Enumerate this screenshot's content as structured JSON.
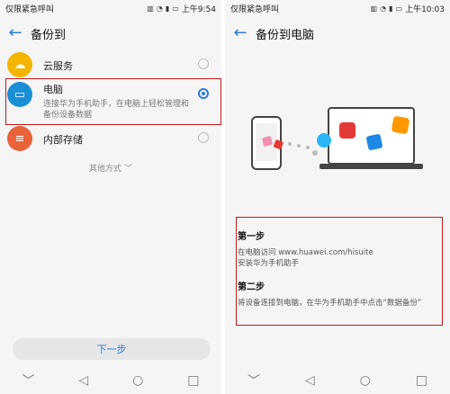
{
  "left": {
    "status": {
      "carrier": "仅限紧急呼叫",
      "time": "上午9:54"
    },
    "title": "备份到",
    "options": [
      {
        "name": "云服务",
        "desc": ""
      },
      {
        "name": "电脑",
        "desc1": "连接华为手机助手，在电脑上轻松管理和",
        "desc2": "备份设备数据"
      },
      {
        "name": "内部存储",
        "desc": ""
      }
    ],
    "more": "其他方式",
    "next_label": "下一步"
  },
  "right": {
    "status": {
      "carrier": "仅限紧急呼叫",
      "time": "上午10:03"
    },
    "title": "备份到电脑",
    "step1": {
      "title": "第一步",
      "line1": "在电脑访问 www.huawei.com/hisuite",
      "line2": "安装华为手机助手"
    },
    "step2": {
      "title": "第二步",
      "line1": "将设备连接到电脑，在华为手机助手中点击“数据备份”"
    }
  },
  "colors": {
    "accent": "#2b7bd8",
    "highlight": "#c01b1b",
    "cloud": "#f4b400",
    "pc": "#1a8fd6",
    "storage": "#e8623a"
  }
}
